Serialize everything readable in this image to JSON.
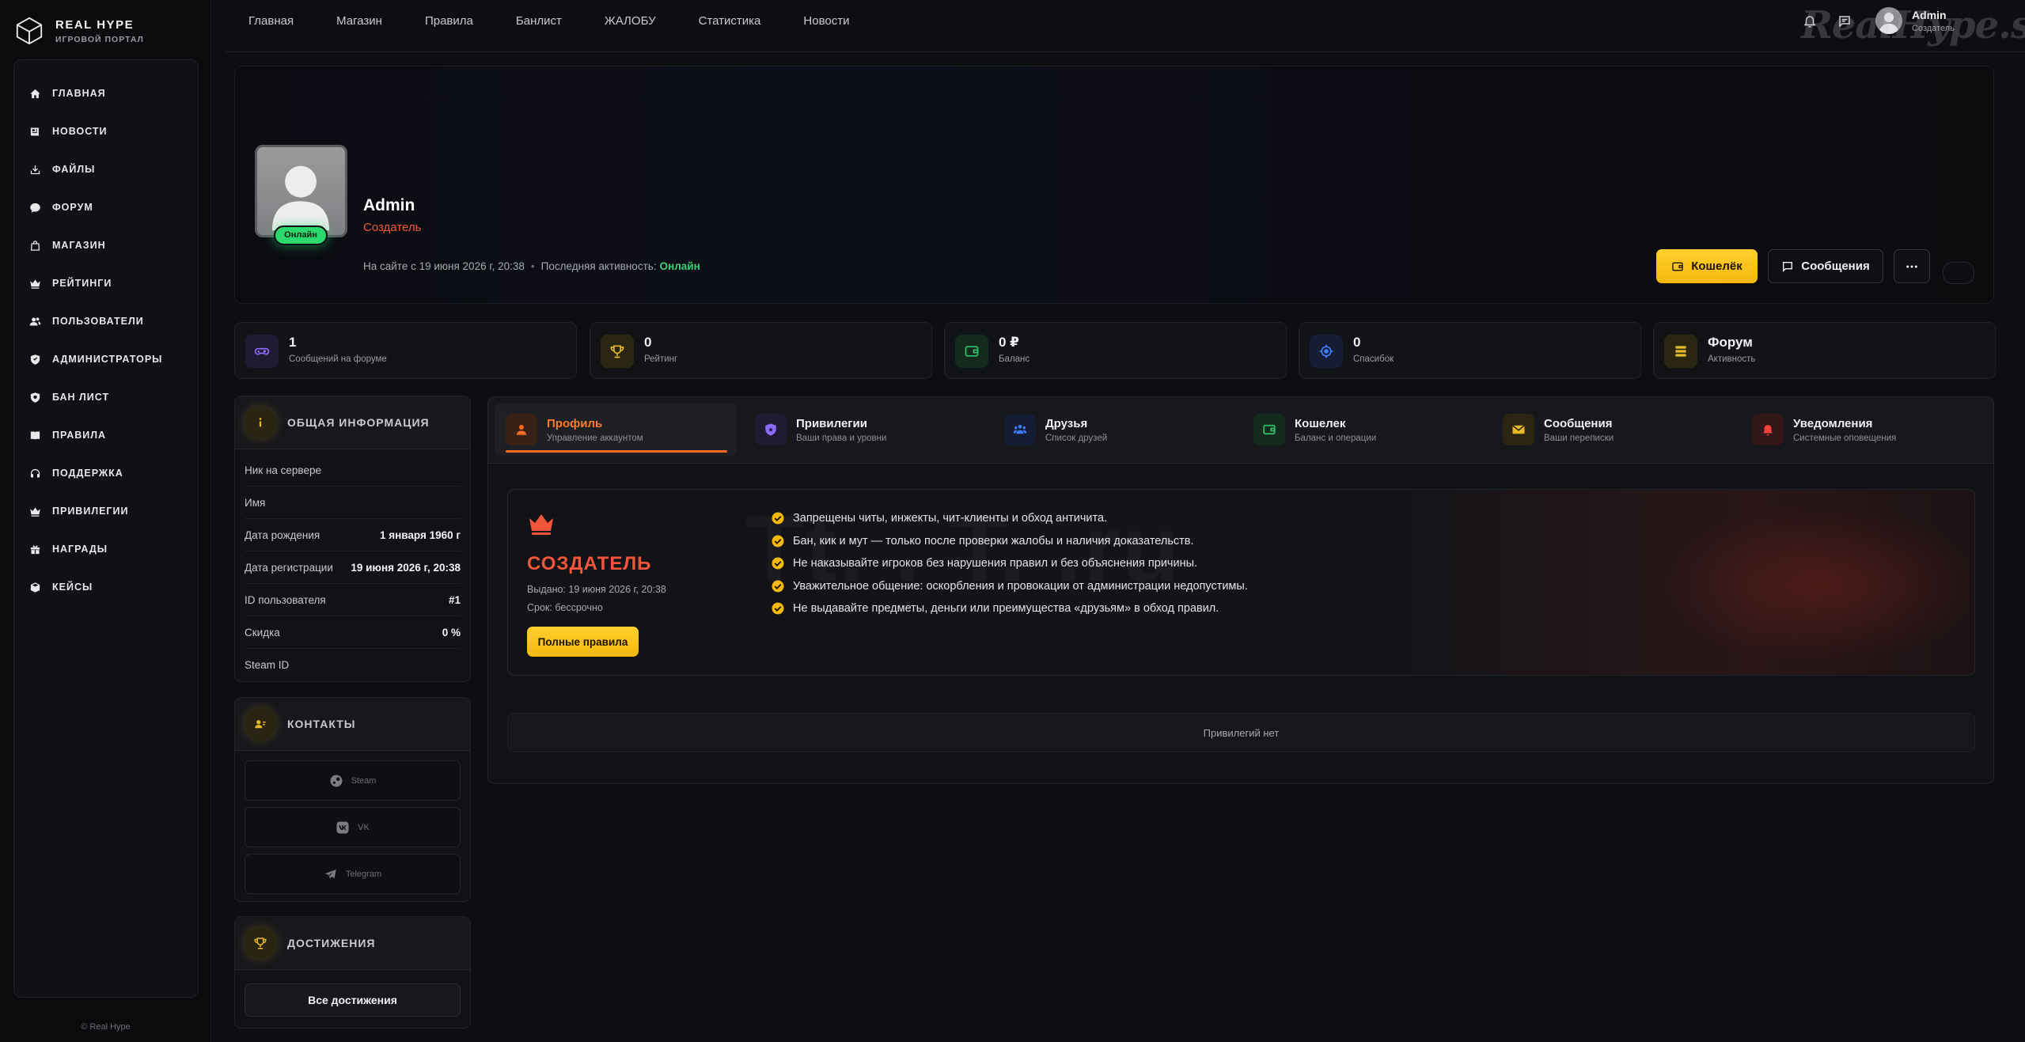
{
  "brand": {
    "title": "REAL HYPE",
    "subtitle": "ИГРОВОЙ ПОРТАЛ"
  },
  "sidebar": {
    "items": [
      {
        "label": "ГЛАВНАЯ",
        "icon": "home-icon"
      },
      {
        "label": "НОВОСТИ",
        "icon": "newspaper-icon"
      },
      {
        "label": "ФАЙЛЫ",
        "icon": "download-icon"
      },
      {
        "label": "ФОРУМ",
        "icon": "chat-bubble-icon"
      },
      {
        "label": "МАГАЗИН",
        "icon": "shopping-bag-icon"
      },
      {
        "label": "РЕЙТИНГИ",
        "icon": "crown-icon"
      },
      {
        "label": "ПОЛЬЗОВАТЕЛИ",
        "icon": "users-icon"
      },
      {
        "label": "АДМИНИСТРАТОРЫ",
        "icon": "shield-icon"
      },
      {
        "label": "БАН ЛИСТ",
        "icon": "ban-shield-icon"
      },
      {
        "label": "ПРАВИЛА",
        "icon": "book-icon"
      },
      {
        "label": "ПОДДЕРЖКА",
        "icon": "headset-icon"
      },
      {
        "label": "ПРИВИЛЕГИИ",
        "icon": "crown-icon"
      },
      {
        "label": "НАГРАДЫ",
        "icon": "gift-icon"
      },
      {
        "label": "КЕЙСЫ",
        "icon": "box-icon"
      }
    ],
    "footer": "© Real Hype"
  },
  "topnav": [
    "Главная",
    "Магазин",
    "Правила",
    "Банлист",
    "ЖАЛОБУ",
    "Статистика",
    "Новости"
  ],
  "topbar": {
    "user_name": "Admin",
    "user_role": "Создатель",
    "watermark": "RealHype.site"
  },
  "profile": {
    "name": "Admin",
    "role": "Создатель",
    "status_badge": "Онлайн",
    "since": "На сайте с 19 июня 2026 г, 20:38",
    "last_activity_label": "Последняя активность:",
    "last_activity_value": "Онлайн",
    "wallet_button": "Кошелёк",
    "messages_button": "Сообщения"
  },
  "stats": [
    {
      "value": "1",
      "label": "Сообщений на форуме",
      "icon": "gamepad-icon",
      "color": "#8b6cff",
      "bg": "#201a33"
    },
    {
      "value": "0",
      "label": "Рейтинг",
      "icon": "trophy-icon",
      "color": "#e7b92a",
      "bg": "#2a2612"
    },
    {
      "value": "0 ₽",
      "label": "Баланс",
      "icon": "wallet-icon",
      "color": "#2fc36a",
      "bg": "#132a1c"
    },
    {
      "value": "0",
      "label": "Спасибок",
      "icon": "target-icon",
      "color": "#3f7bff",
      "bg": "#141d33"
    },
    {
      "value": "Форум",
      "label": "Активность",
      "icon": "server-icon",
      "color": "#e7b92a",
      "bg": "#2a2612"
    }
  ],
  "info": {
    "title": "ОБЩАЯ ИНФОРМАЦИЯ",
    "rows": [
      {
        "k": "Ник на сервере",
        "v": ""
      },
      {
        "k": "Имя",
        "v": ""
      },
      {
        "k": "Дата рождения",
        "v": "1 января 1960 г"
      },
      {
        "k": "Дата регистрации",
        "v": "19 июня 2026 г, 20:38"
      },
      {
        "k": "ID пользователя",
        "v": "#1"
      },
      {
        "k": "Скидка",
        "v": "0 %"
      },
      {
        "k": "Steam ID",
        "v": ""
      }
    ]
  },
  "contacts": {
    "title": "КОНТАКТЫ",
    "items": [
      "Steam",
      "VK",
      "Telegram"
    ]
  },
  "achievements": {
    "title": "ДОСТИЖЕНИЯ",
    "button": "Все достижения"
  },
  "tabs": [
    {
      "label": "Профиль",
      "sub": "Управление аккаунтом",
      "icon": "user-icon",
      "color": "#ff6a24",
      "bg": "#3a2116"
    },
    {
      "label": "Привилегии",
      "sub": "Ваши права и уровни",
      "icon": "shield-icon",
      "color": "#8b6cff",
      "bg": "#201a33"
    },
    {
      "label": "Друзья",
      "sub": "Список друзей",
      "icon": "users-icon",
      "color": "#3f7bff",
      "bg": "#141d33"
    },
    {
      "label": "Кошелек",
      "sub": "Баланс и операции",
      "icon": "wallet-icon",
      "color": "#2fc36a",
      "bg": "#132a1c"
    },
    {
      "label": "Сообщения",
      "sub": "Ваши переписки",
      "icon": "envelope-icon",
      "color": "#e7b92a",
      "bg": "#2a2612"
    },
    {
      "label": "Уведомления",
      "sub": "Системные оповещения",
      "icon": "bell-icon",
      "color": "#f0443a",
      "bg": "#331618"
    }
  ],
  "role_card": {
    "name": "СОЗДАТЕЛЬ",
    "issued": "Выдано: 19 июня 2026 г, 20:38",
    "term": "Срок: бессрочно",
    "rules_button": "Полные правила",
    "watermark": "Tt. . T. .ru",
    "rules": [
      "Запрещены читы, инжекты, чит-клиенты и обход античита.",
      "Бан, кик и мут — только после проверки жалобы и наличия доказательств.",
      "Не наказывайте игроков без нарушения правил и без объяснения причины.",
      "Уважительное общение: оскорбления и провокации от администрации недопустимы.",
      "Не выдавайте предметы, деньги или преимущества «друзьям» в обход правил."
    ]
  },
  "no_privileges": "Привилегий нет"
}
